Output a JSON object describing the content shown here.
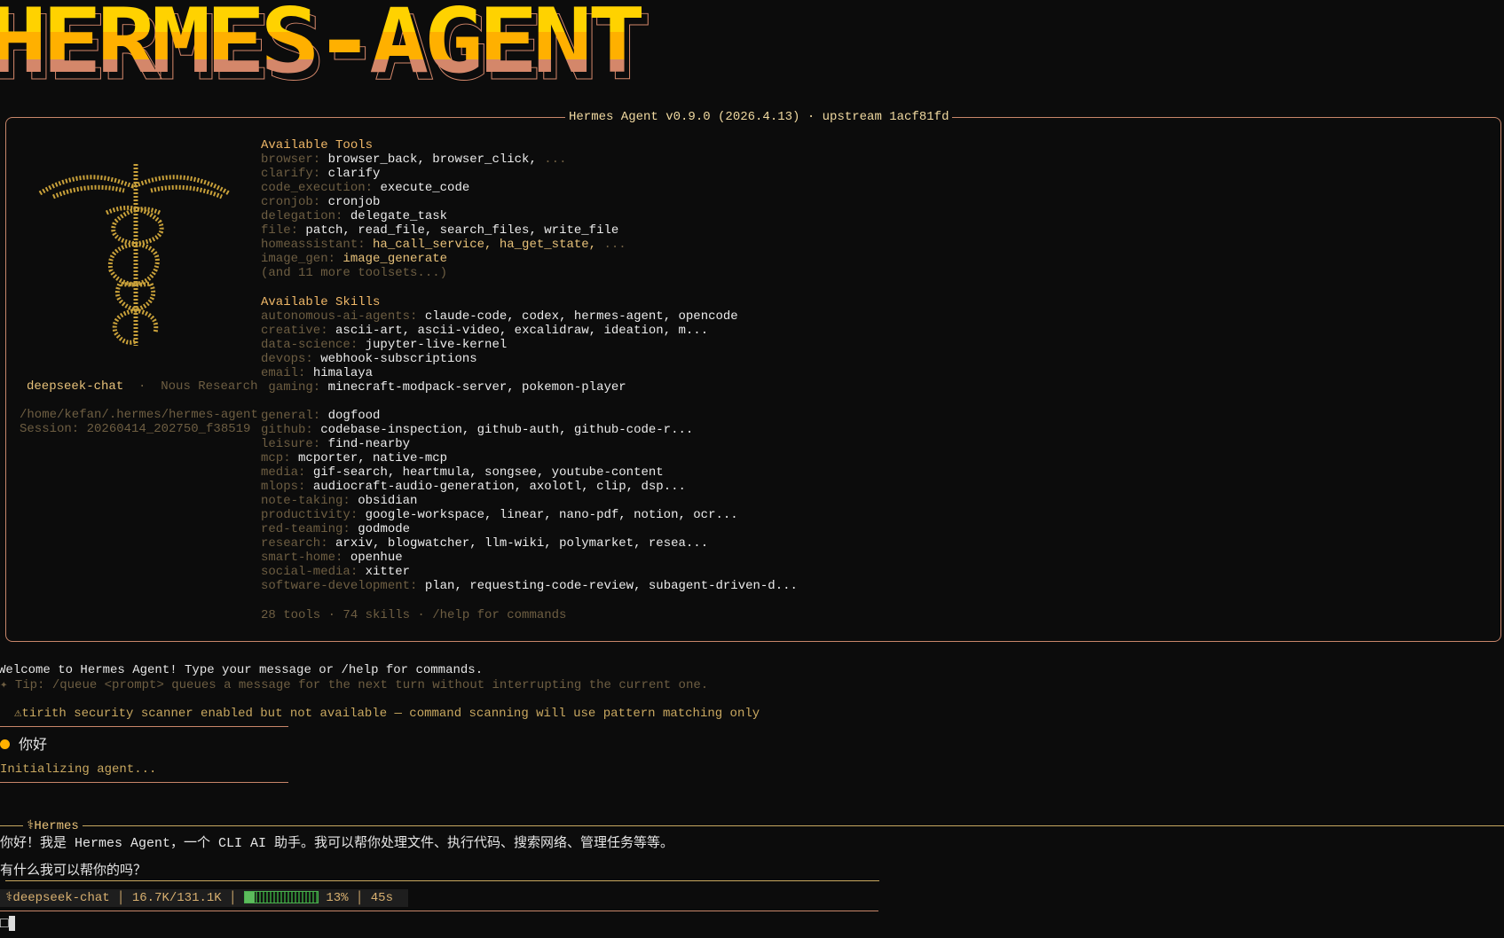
{
  "banner": "HERMES-AGENT",
  "box_title": "Hermes Agent v0.9.0 (2026.4.13) · upstream 1acf81fd",
  "left_panel": {
    "model": "deepseek-chat",
    "sep": "·",
    "org": "Nous Research",
    "path": "/home/kefan/.hermes/hermes-agent",
    "session": "Session: 20260414_202750_f38519"
  },
  "tools": {
    "heading": "Available Tools",
    "items": [
      {
        "k": "browser:",
        "v": "browser_back, browser_click,",
        "more": " ..."
      },
      {
        "k": "clarify:",
        "v": "clarify"
      },
      {
        "k": "code_execution:",
        "v": "execute_code"
      },
      {
        "k": "cronjob:",
        "v": "cronjob"
      },
      {
        "k": "delegation:",
        "v": "delegate_task"
      },
      {
        "k": "file:",
        "v": "patch, read_file, search_files, write_file"
      },
      {
        "k": "homeassistant:",
        "v": "ha_call_service, ha_get_state,",
        "more": " ..."
      },
      {
        "k": "image_gen:",
        "v": "image_generate"
      }
    ],
    "more": "(and 11 more toolsets...)"
  },
  "skills": {
    "heading": "Available Skills",
    "items": [
      {
        "k": "autonomous-ai-agents:",
        "v": "claude-code, codex, hermes-agent, opencode"
      },
      {
        "k": "creative:",
        "v": "ascii-art, ascii-video, excalidraw, ideation, m..."
      },
      {
        "k": "data-science:",
        "v": "jupyter-live-kernel"
      },
      {
        "k": "devops:",
        "v": "webhook-subscriptions"
      },
      {
        "k": "email:",
        "v": "himalaya"
      },
      {
        "k": " gaming:",
        "v": "minecraft-modpack-server, pokemon-player"
      },
      {
        "k": "",
        "v": ""
      },
      {
        "k": "general:",
        "v": "dogfood"
      },
      {
        "k": "github:",
        "v": "codebase-inspection, github-auth, github-code-r..."
      },
      {
        "k": "leisure:",
        "v": "find-nearby"
      },
      {
        "k": "mcp:",
        "v": "mcporter, native-mcp"
      },
      {
        "k": "media:",
        "v": "gif-search, heartmula, songsee, youtube-content"
      },
      {
        "k": "mlops:",
        "v": "audiocraft-audio-generation, axolotl, clip, dsp..."
      },
      {
        "k": "note-taking:",
        "v": "obsidian"
      },
      {
        "k": "productivity:",
        "v": "google-workspace, linear, nano-pdf, notion, ocr..."
      },
      {
        "k": "red-teaming:",
        "v": "godmode"
      },
      {
        "k": "research:",
        "v": "arxiv, blogwatcher, llm-wiki, polymarket, resea..."
      },
      {
        "k": "smart-home:",
        "v": "openhue"
      },
      {
        "k": "social-media:",
        "v": "xitter"
      },
      {
        "k": "software-development:",
        "v": "plan, requesting-code-review, subagent-driven-d..."
      }
    ]
  },
  "summary": "28 tools · 74 skills · /help for commands",
  "welcome": "Welcome to Hermes Agent! Type your message or /help for commands.",
  "tip": "✦ Tip: /queue <prompt> queues a message for the next turn without interrupting the current one.",
  "warning": "⚠tirith security scanner enabled but not available — command scanning will use pattern matching only",
  "user_message": "你好",
  "initializing": "Initializing agent...",
  "response_label": "⚕Hermes",
  "response_lines": [
    "你好！我是 Hermes Agent，一个 CLI AI 助手。我可以帮你处理文件、执行代码、搜索网络、管理任务等等。",
    "有什么我可以帮你的吗？"
  ],
  "status": {
    "model": "⚕deepseek-chat",
    "tokens": "16.7K/131.1K",
    "percent": "13%",
    "progress": 13,
    "time": "45s"
  },
  "colors": {
    "border": "#c8866a",
    "accent": "#f0b868",
    "progress": "#5cbc5c",
    "user_dot": "#ffb000"
  }
}
